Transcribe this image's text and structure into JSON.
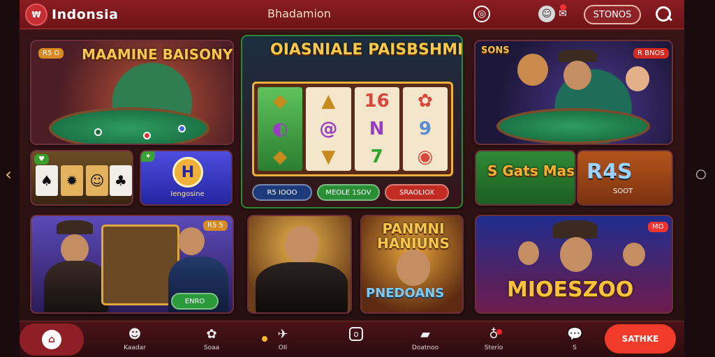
{
  "header": {
    "logo_text": "₩",
    "brand_name": "Indonsia",
    "center_title": "Bhadamion",
    "cta_label": "STONOS"
  },
  "icons": {
    "globe": "globe-icon",
    "bell": "bell-icon",
    "search": "search-icon"
  },
  "tiles": {
    "t1": {
      "title": "MAAMINE BAISONY",
      "badge": ""
    },
    "t2": {
      "title": "OIASNIALE PAISBSHMEAIDO",
      "pills": [
        "R5 IOOO",
        "MEOLE 1SOV",
        "SRAOLIOX"
      ]
    },
    "t3": {
      "title": "SONS",
      "badge": "R BNOS"
    },
    "t4": {
      "title": ""
    },
    "t5": {
      "title": "H",
      "subtitle": "Iengosine"
    },
    "t6": {
      "title": "S Gats Masters"
    },
    "t7": {
      "title": "R4S",
      "subtitle": "SOOT"
    },
    "t8": {
      "badge": "",
      "button": "ENRO"
    },
    "t10": {
      "title": "PANMNI HANIUNS",
      "subtitle": "PNEDOANS"
    },
    "t11": {
      "title": "MIOESZOO"
    }
  },
  "nav": {
    "items": [
      {
        "label": "Kaadar",
        "icon": "user-icon"
      },
      {
        "label": "Soaa",
        "icon": "dice-icon"
      },
      {
        "label": "OII",
        "icon": "rocket-icon"
      },
      {
        "label": "",
        "icon": "square-icon"
      },
      {
        "label": "Doatnoo",
        "icon": "wallet-icon"
      },
      {
        "label": "Sterio",
        "icon": "shield-icon"
      },
      {
        "label": "S",
        "icon": "chat-icon"
      }
    ],
    "cta_label": "SATHKE"
  }
}
